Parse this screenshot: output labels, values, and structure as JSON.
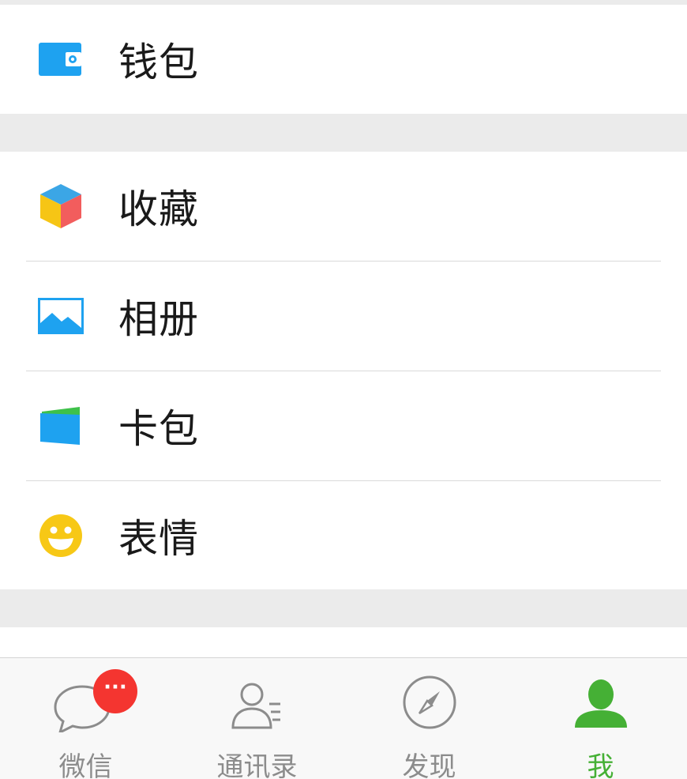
{
  "colors": {
    "background": "#ebebeb",
    "cell": "#ffffff",
    "accent_green": "#45b035",
    "badge_red": "#f43530",
    "tab_inactive": "#8c8c8c",
    "blue_icon": "#20a3f1"
  },
  "menu": {
    "wallet": {
      "label": "钱包",
      "icon": "wallet-icon"
    },
    "favorites": {
      "label": "收藏",
      "icon": "cube-icon"
    },
    "album": {
      "label": "相册",
      "icon": "photo-icon"
    },
    "cards": {
      "label": "卡包",
      "icon": "card-wallet-icon"
    },
    "stickers": {
      "label": "表情",
      "icon": "smiley-icon"
    }
  },
  "tabbar": {
    "chats": {
      "label": "微信",
      "icon": "chat-bubble-icon",
      "badge": "···"
    },
    "contacts": {
      "label": "通讯录",
      "icon": "contacts-icon"
    },
    "discover": {
      "label": "发现",
      "icon": "compass-icon"
    },
    "me": {
      "label": "我",
      "icon": "person-icon",
      "active": true
    }
  }
}
